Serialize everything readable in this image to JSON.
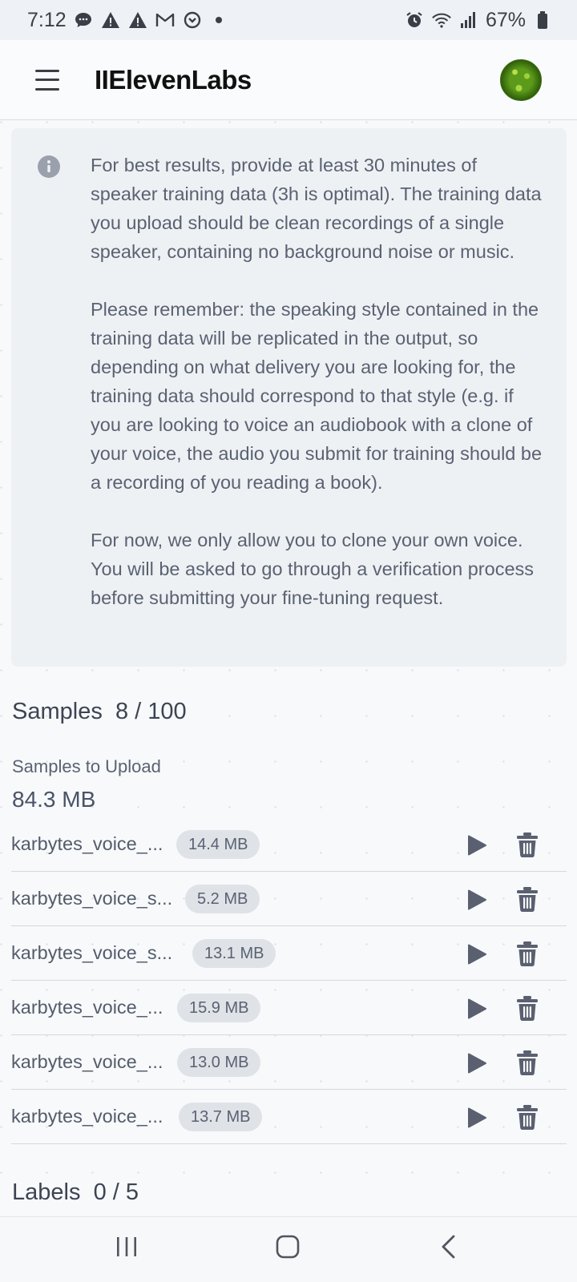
{
  "status_bar": {
    "time": "7:12",
    "battery": "67%",
    "left_icons": [
      "chat-bubble-icon",
      "warning-icon",
      "warning-icon",
      "gmail-icon",
      "media-icon",
      "dot-icon"
    ],
    "right_icons": [
      "alarm-icon",
      "wifi-icon",
      "signal-icon",
      "battery-icon"
    ]
  },
  "header": {
    "logo": "IIElevenLabs",
    "menu_icon": "hamburger-menu-icon",
    "avatar": "user-avatar"
  },
  "info": {
    "icon": "info-icon",
    "paragraph1": "For best results, provide at least 30 minutes of speaker training data (3h is optimal). The training data you upload should be clean recordings of a single speaker, containing no background noise or music.",
    "paragraph2": "Please remember: the speaking style contained in the training data will be replicated in the output, so depending on what delivery you are looking for, the training data should correspond to that style (e.g. if you are looking to voice an audiobook with a clone of your voice, the audio you submit for training should be a recording of you reading a book).",
    "paragraph3": "For now, we only allow you to clone your own voice. You will be asked to go through a verification process before submitting your fine-tuning request."
  },
  "samples": {
    "title": "Samples",
    "count": "8 / 100",
    "upload_label": "Samples to Upload",
    "upload_total": "84.3 MB",
    "items": [
      {
        "name": "karbytes_voice_...",
        "size": "14.4 MB"
      },
      {
        "name": "karbytes_voice_s...",
        "size": "5.2 MB"
      },
      {
        "name": "karbytes_voice_s...",
        "size": "13.1 MB"
      },
      {
        "name": "karbytes_voice_...",
        "size": "15.9 MB"
      },
      {
        "name": "karbytes_voice_...",
        "size": "13.0 MB"
      },
      {
        "name": "karbytes_voice_...",
        "size": "13.7 MB"
      }
    ]
  },
  "labels": {
    "title": "Labels",
    "count": "0 / 5"
  },
  "nav_bar": {
    "recents": "recents-icon",
    "home": "home-icon",
    "back": "back-icon"
  },
  "colors": {
    "background": "#f7f9fb",
    "info_box": "#eef1f4",
    "badge": "#dfe2e7",
    "icon": "#5a6070"
  }
}
